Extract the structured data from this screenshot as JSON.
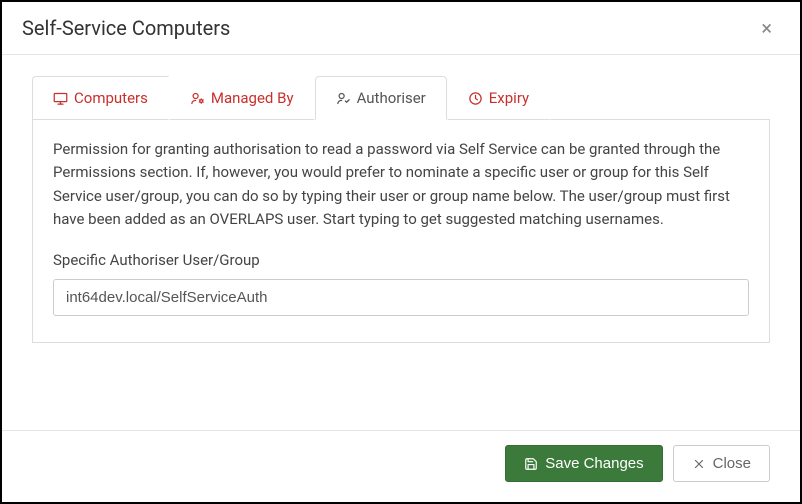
{
  "dialog": {
    "title": "Self-Service Computers"
  },
  "tabs": {
    "computers": "Computers",
    "managed_by": "Managed By",
    "authoriser": "Authoriser",
    "expiry": "Expiry"
  },
  "authoriser_panel": {
    "description": "Permission for granting authorisation to read a password via Self Service can be granted through the Permissions section. If, however, you would prefer to nominate a specific user or group for this Self Service user/group, you can do so by typing their user or group name below. The user/group must first have been added as an OVERLAPS user. Start typing to get suggested matching usernames.",
    "field_label": "Specific Authoriser User/Group",
    "field_value": "int64dev.local/SelfServiceAuth"
  },
  "footer": {
    "save_label": "Save Changes",
    "close_label": "Close"
  },
  "colors": {
    "accent_red": "#c9302c",
    "primary_green": "#3b7a3b"
  }
}
